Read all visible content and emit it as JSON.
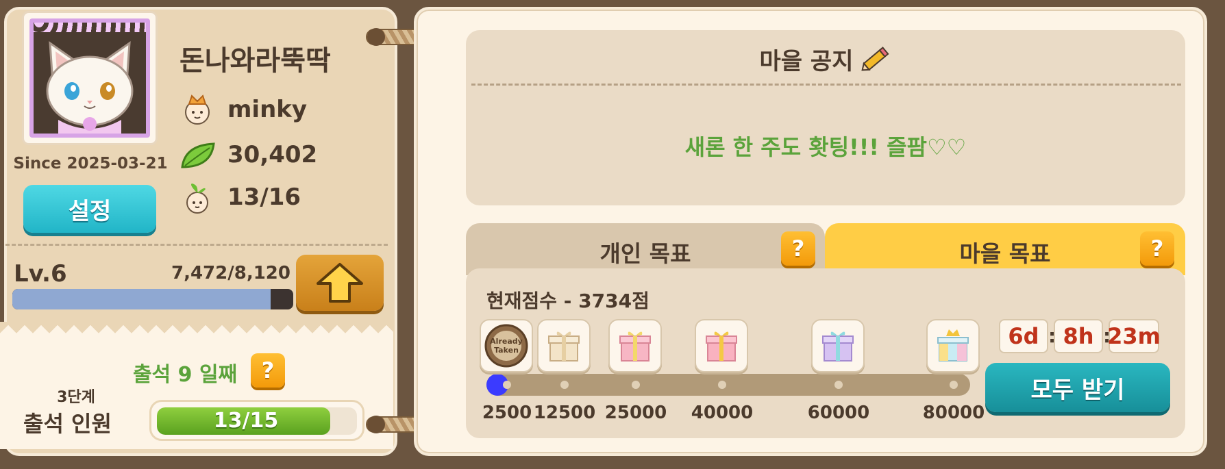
{
  "profile": {
    "nickname": "돈나와라뚝딱",
    "since": "Since 2025-03-21",
    "settings_label": "설정",
    "village_name": "minky",
    "leaves": "30,402",
    "members": "13/16",
    "icons": {
      "crown": "crown-person-icon",
      "leaf": "leaf-icon",
      "sprout": "sprout-person-icon"
    }
  },
  "level": {
    "label": "Lv.6",
    "exp_text": "7,472/8,120",
    "exp_fraction": 0.92,
    "upgrade_icon": "up-arrow-icon"
  },
  "attendance": {
    "days_label": "출석 9 일째",
    "help_label": "?",
    "stage_label": "3단계",
    "members_label": "출석 인원",
    "progress_text": "13/15",
    "progress_fraction": 0.867
  },
  "notice": {
    "title": "마을 공지",
    "message": "새론 한 주도 홧팅!!! 즐팜♡♡",
    "edit_icon": "pencil-icon"
  },
  "tabs": {
    "personal": "개인 목표",
    "village": "마을 목표",
    "help_label": "?",
    "active": "village"
  },
  "goal": {
    "score_label": "현재점수 - 3734점",
    "progress_fraction": 0.0,
    "milestones": [
      {
        "label": "2500",
        "reward": "already-taken-badge",
        "badge_text": "Already Taken"
      },
      {
        "label": "12500",
        "reward": "gift-box-cream"
      },
      {
        "label": "25000",
        "reward": "gift-box-pink"
      },
      {
        "label": "40000",
        "reward": "gift-box-pink"
      },
      {
        "label": "60000",
        "reward": "gift-box-purple"
      },
      {
        "label": "80000",
        "reward": "gift-box-rainbow-crown"
      }
    ],
    "timer": {
      "days": "6d",
      "hours": "8h",
      "minutes": "23m",
      "sep": ":"
    },
    "claim_all_label": "모두 받기"
  },
  "colors": {
    "accent_green": "#5ba33b",
    "teal_button": "#21b5c7",
    "tab_active": "#ffcd45",
    "timer_red": "#c0331b"
  }
}
